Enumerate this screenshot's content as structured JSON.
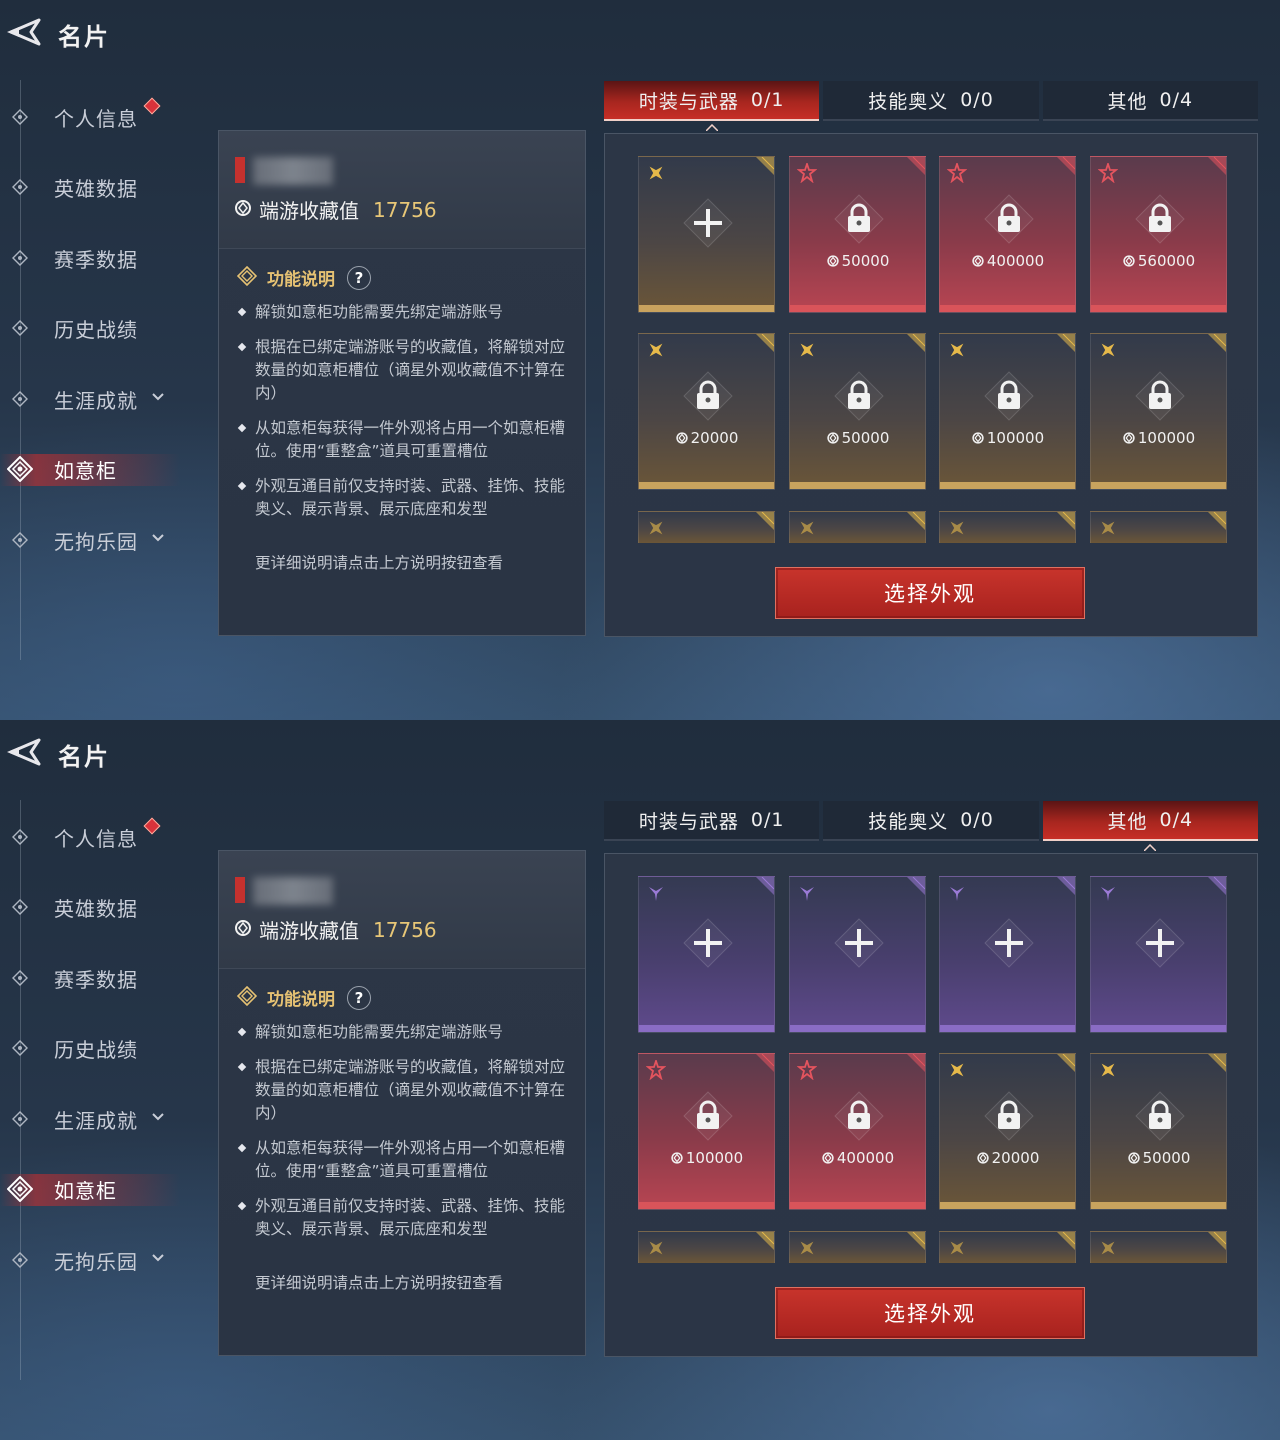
{
  "screens": [
    {
      "header": {
        "title": "名片"
      },
      "sidebar": {
        "items": [
          {
            "label": "个人信息",
            "badge": true,
            "chevron": false,
            "active": false
          },
          {
            "label": "英雄数据",
            "badge": false,
            "chevron": false,
            "active": false
          },
          {
            "label": "赛季数据",
            "badge": false,
            "chevron": false,
            "active": false
          },
          {
            "label": "历史战绩",
            "badge": false,
            "chevron": false,
            "active": false
          },
          {
            "label": "生涯成就",
            "badge": false,
            "chevron": true,
            "active": false
          },
          {
            "label": "如意柜",
            "badge": false,
            "chevron": false,
            "active": true
          },
          {
            "label": "无拘乐园",
            "badge": false,
            "chevron": true,
            "active": false
          }
        ]
      },
      "info": {
        "collection_label": "端游收藏值",
        "collection_value": "17756",
        "function_title": "功能说明",
        "help_label": "?",
        "bullets": [
          "解锁如意柜功能需要先绑定端游账号",
          "根据在已绑定端游账号的收藏值，将解锁对应数量的如意柜槽位（谪星外观收藏值不计算在内）",
          "从如意柜每获得一件外观将占用一个如意柜槽位。使用“重整盒”道具可重置槽位",
          "外观互通目前仅支持时装、武器、挂饰、技能奥义、展示背景、展示底座和发型"
        ],
        "note": "更详细说明请点击上方说明按钮查看"
      },
      "tabs": [
        {
          "label": "时装与武器",
          "count": "0/1",
          "active": true
        },
        {
          "label": "技能奥义",
          "count": "0/0",
          "active": false
        },
        {
          "label": "其他",
          "count": "0/4",
          "active": false
        }
      ],
      "slots": [
        {
          "tier": "gold",
          "state": "add",
          "cost": ""
        },
        {
          "tier": "red",
          "state": "locked",
          "cost": "50000"
        },
        {
          "tier": "red",
          "state": "locked",
          "cost": "400000"
        },
        {
          "tier": "red",
          "state": "locked",
          "cost": "560000"
        },
        {
          "tier": "gold",
          "state": "locked",
          "cost": "20000"
        },
        {
          "tier": "gold",
          "state": "locked",
          "cost": "50000"
        },
        {
          "tier": "gold",
          "state": "locked",
          "cost": "100000"
        },
        {
          "tier": "gold",
          "state": "locked",
          "cost": "100000"
        },
        {
          "tier": "gold",
          "state": "partial",
          "cost": ""
        },
        {
          "tier": "gold",
          "state": "partial",
          "cost": ""
        },
        {
          "tier": "gold",
          "state": "partial",
          "cost": ""
        },
        {
          "tier": "gold",
          "state": "partial",
          "cost": ""
        }
      ],
      "select_button": "选择外观"
    },
    {
      "header": {
        "title": "名片"
      },
      "sidebar": {
        "items": [
          {
            "label": "个人信息",
            "badge": true,
            "chevron": false,
            "active": false
          },
          {
            "label": "英雄数据",
            "badge": false,
            "chevron": false,
            "active": false
          },
          {
            "label": "赛季数据",
            "badge": false,
            "chevron": false,
            "active": false
          },
          {
            "label": "历史战绩",
            "badge": false,
            "chevron": false,
            "active": false
          },
          {
            "label": "生涯成就",
            "badge": false,
            "chevron": true,
            "active": false
          },
          {
            "label": "如意柜",
            "badge": false,
            "chevron": false,
            "active": true
          },
          {
            "label": "无拘乐园",
            "badge": false,
            "chevron": true,
            "active": false
          }
        ]
      },
      "info": {
        "collection_label": "端游收藏值",
        "collection_value": "17756",
        "function_title": "功能说明",
        "help_label": "?",
        "bullets": [
          "解锁如意柜功能需要先绑定端游账号",
          "根据在已绑定端游账号的收藏值，将解锁对应数量的如意柜槽位（谪星外观收藏值不计算在内）",
          "从如意柜每获得一件外观将占用一个如意柜槽位。使用“重整盒”道具可重置槽位",
          "外观互通目前仅支持时装、武器、挂饰、技能奥义、展示背景、展示底座和发型"
        ],
        "note": "更详细说明请点击上方说明按钮查看"
      },
      "tabs": [
        {
          "label": "时装与武器",
          "count": "0/1",
          "active": false
        },
        {
          "label": "技能奥义",
          "count": "0/0",
          "active": false
        },
        {
          "label": "其他",
          "count": "0/4",
          "active": true
        }
      ],
      "slots": [
        {
          "tier": "purple",
          "state": "add",
          "cost": ""
        },
        {
          "tier": "purple",
          "state": "add",
          "cost": ""
        },
        {
          "tier": "purple",
          "state": "add",
          "cost": ""
        },
        {
          "tier": "purple",
          "state": "add",
          "cost": ""
        },
        {
          "tier": "red",
          "state": "locked",
          "cost": "100000"
        },
        {
          "tier": "red",
          "state": "locked",
          "cost": "400000"
        },
        {
          "tier": "gold",
          "state": "locked",
          "cost": "20000"
        },
        {
          "tier": "gold",
          "state": "locked",
          "cost": "50000"
        },
        {
          "tier": "gold",
          "state": "partial",
          "cost": ""
        },
        {
          "tier": "gold",
          "state": "partial",
          "cost": ""
        },
        {
          "tier": "gold",
          "state": "partial",
          "cost": ""
        },
        {
          "tier": "gold",
          "state": "partial",
          "cost": ""
        }
      ],
      "select_button": "选择外观"
    }
  ],
  "colors": {
    "gold": "#e6b94a",
    "red": "#e4545e",
    "purple": "#9b7ad6",
    "accent": "#c62e26"
  }
}
